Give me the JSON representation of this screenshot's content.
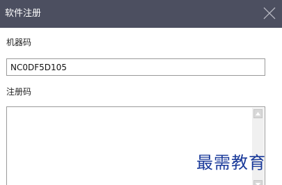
{
  "window": {
    "title": "软件注册",
    "close_icon": "close-icon"
  },
  "form": {
    "machine_code_label": "机器码",
    "machine_code_value": "NC0DF5D105",
    "registration_code_label": "注册码",
    "registration_code_value": ""
  },
  "scrollbar": {
    "up_icon": "scroll-up-arrow-icon",
    "down_icon": "scroll-down-arrow-icon"
  },
  "watermark": {
    "text": "最需教育"
  },
  "colors": {
    "titlebar": "#4c4f60",
    "title_text": "#ffffff",
    "watermark": "#1a3a9a"
  }
}
